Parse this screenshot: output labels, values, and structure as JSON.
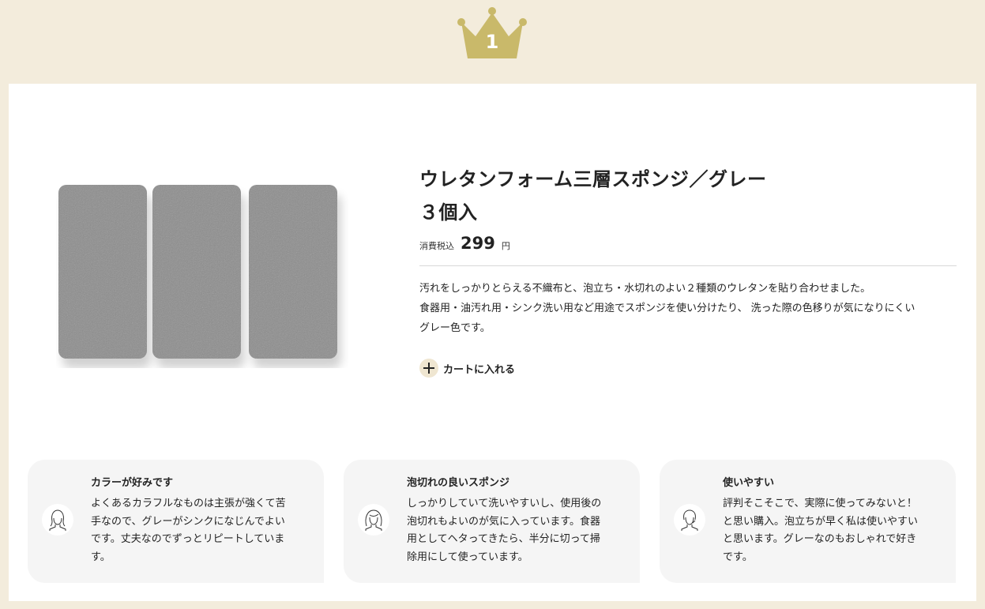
{
  "rank": {
    "number": "1",
    "crown_color": "#c9b96a"
  },
  "product": {
    "title_line1": "ウレタンフォーム三層スポンジ／グレー",
    "title_line2": "３個入",
    "tax_label": "消費税込",
    "price": "299",
    "currency": "円",
    "description": [
      "汚れをしっかりとらえる不織布と、泡立ち・水切れのよい２種類のウレタンを貼り合わせました。",
      "食器用・油汚れ用・シンク洗い用など用途でスポンジを使い分けたり、 洗った際の色移りが気になりにくい",
      "グレー色です。"
    ],
    "cart_label": "カートに入れる",
    "image_icon": "sponge-product-image"
  },
  "reviews": [
    {
      "title": "カラーが好みです",
      "lines": [
        "よくあるカラフルなものは主張が強くて苦",
        "手なので、グレーがシンクになじんでよい",
        "です。丈夫なのでずっとリピートしていま",
        "す。"
      ]
    },
    {
      "title": "泡切れの良いスポンジ",
      "lines": [
        "しっかりしていて洗いやすいし、使用後の",
        "泡切れもよいのが気に入っています。食器",
        "用としてヘタってきたら、半分に切って掃",
        "除用にして使っています。"
      ]
    },
    {
      "title": "使いやすい",
      "lines": [
        "評判そこそこで、実際に使ってみないと！",
        "と思い購入。泡立ちが早く私は使いやすい",
        "と思います。グレーなのもおしゃれで好き",
        "です。"
      ]
    }
  ],
  "colors": {
    "page_bg": "#f3ecdc",
    "card_bg": "#ffffff",
    "review_bg": "#f5f5f5",
    "cart_icon_bg": "#efe6d1"
  }
}
